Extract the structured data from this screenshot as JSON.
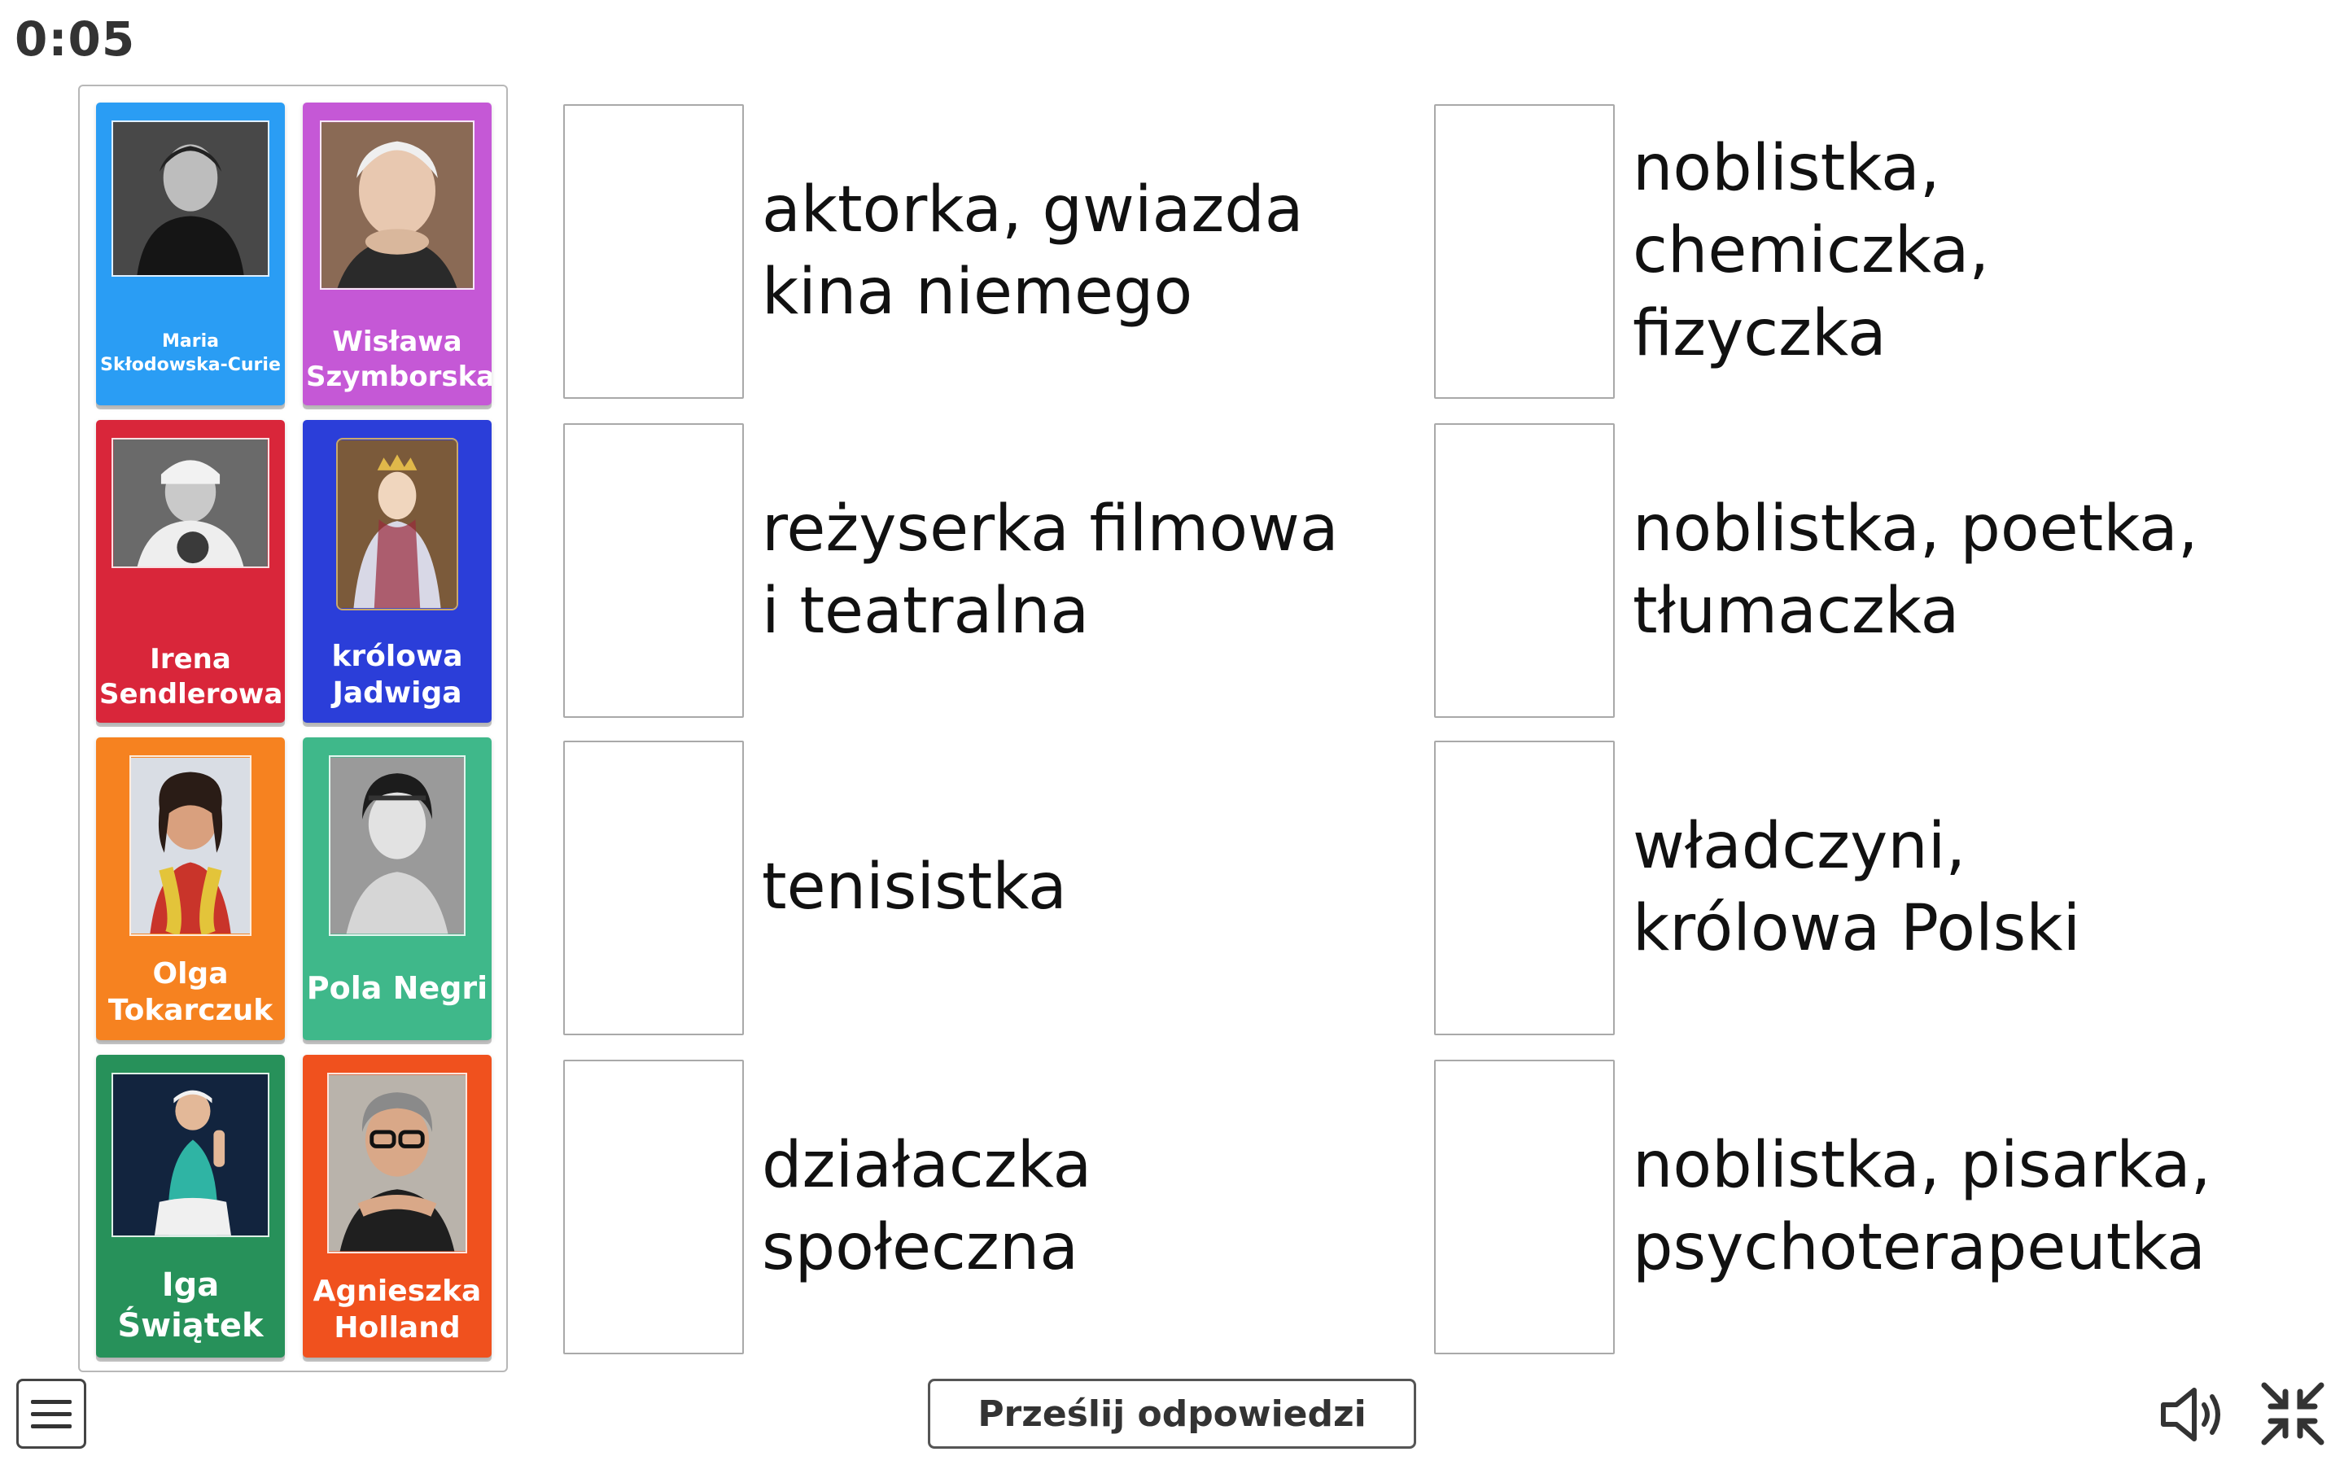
{
  "timer": "0:05",
  "cards": [
    {
      "name": "Maria\nSkłodowska-Curie",
      "color": "#2a9df4",
      "photo": "portrait-maria-sklodowska-curie"
    },
    {
      "name": "Wisława\nSzymborska",
      "color": "#c558d6",
      "photo": "portrait-wislawa-szymborska"
    },
    {
      "name": "Irena\nSendlerowa",
      "color": "#d9263a",
      "photo": "portrait-irena-sendlerowa"
    },
    {
      "name": "królowa\nJadwiga",
      "color": "#2b3ed9",
      "photo": "portrait-krolowa-jadwiga"
    },
    {
      "name": "Olga\nTokarczuk",
      "color": "#f68220",
      "photo": "portrait-olga-tokarczuk"
    },
    {
      "name": "Pola Negri",
      "color": "#3fb88a",
      "photo": "portrait-pola-negri"
    },
    {
      "name": "Iga\nŚwiątek",
      "color": "#27915a",
      "photo": "portrait-iga-swiatek"
    },
    {
      "name": "Agnieszka\nHolland",
      "color": "#f0511e",
      "photo": "portrait-agnieszka-holland"
    }
  ],
  "descriptions": [
    {
      "text": "aktorka, gwiazda\nkina niemego"
    },
    {
      "text": "noblistka,\nchemiczka,\nfizyczka"
    },
    {
      "text": "reżyserka filmowa\ni teatralna"
    },
    {
      "text": "noblistka, poetka,\ntłumaczka"
    },
    {
      "text": "tenisistka"
    },
    {
      "text": "władczyni,\nkrólowa Polski"
    },
    {
      "text": "działaczka\nspołeczna"
    },
    {
      "text": "noblistka, pisarka,\npsychoterapeutka"
    }
  ],
  "toolbar": {
    "submit_label": "Prześlij odpowiedzi",
    "menu_icon": "hamburger-menu-icon",
    "sound_icon": "speaker-icon",
    "exit_fullscreen_icon": "exit-fullscreen-icon"
  }
}
